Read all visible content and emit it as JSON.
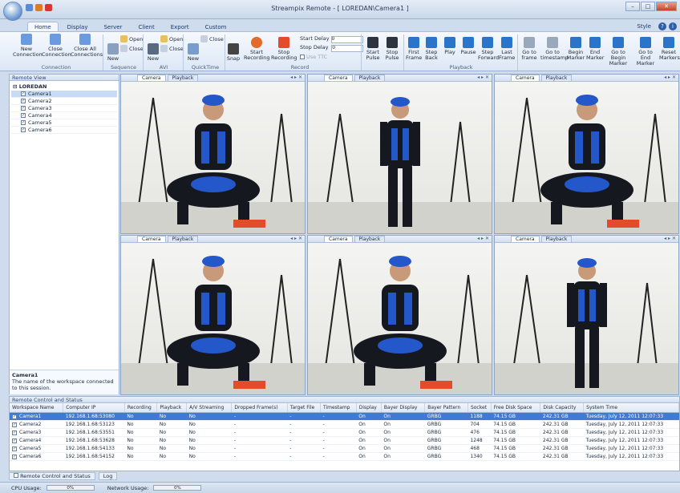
{
  "window": {
    "title": "Streampix Remote - [ LOREDAN\\Camera1 ]",
    "style_label": "Style"
  },
  "ribbon_tabs": [
    "Home",
    "Display",
    "Server",
    "Client",
    "Export",
    "Custom"
  ],
  "ribbon": {
    "new_connection": "New Connection",
    "close_connection": "Close Connection",
    "close_all": "Close All Connections",
    "group_connection": "Connection",
    "seq_new": "New",
    "seq_open": "Open",
    "seq_close": "Close",
    "group_sequence": "Sequence",
    "avi_new": "New",
    "avi_open": "Open",
    "avi_close": "Close",
    "group_avi": "AVI",
    "qt_new": "New",
    "qt_close": "Close",
    "group_qt": "QuickTime",
    "snap": "Snap",
    "start_recording": "Start Recording",
    "stop_recording": "Stop Recording",
    "start_delay_label": "Start Delay",
    "start_delay_value": "0",
    "stop_delay_label": "Stop Delay",
    "stop_delay_value": "0",
    "use_ttc": "Use TTC",
    "group_record": "Record",
    "start_pulse": "Start Pulse",
    "stop_pulse": "Stop Pulse",
    "first_frame": "First Frame",
    "step_back": "Step Back",
    "play": "Play",
    "pause": "Pause",
    "step_forward": "Step Forward",
    "last_frame": "Last Frame",
    "group_playback": "Playback",
    "go_to_frame": "Go to frame",
    "go_to_timestamp": "Go to timestamp",
    "begin_marker": "Begin Marker",
    "end_marker": "End Marker",
    "go_begin_marker": "Go to Begin Marker",
    "go_end_marker": "Go to End Marker",
    "reset_markers": "Reset Markers"
  },
  "remote_view": {
    "title": "Remote View",
    "root": "LOREDAN",
    "cameras": [
      "Camera1",
      "Camera2",
      "Camera3",
      "Camera4",
      "Camera5",
      "Camera6"
    ],
    "selected_name": "Camera1",
    "selected_desc": "The name of the workspace connected to this session."
  },
  "pane_tabs": {
    "camera": "Camera",
    "playback": "Playback"
  },
  "status_panel": {
    "title": "Remote Control and Status",
    "columns": [
      "Workspace Name",
      "Computer IP",
      "Recording",
      "Playback",
      "A/V Streaming",
      "Dropped Frame(s)",
      "Target File",
      "Timestamp",
      "Display",
      "Bayer Display",
      "Bayer Pattern",
      "Socket",
      "Free Disk Space",
      "Disk Capacity",
      "System Time"
    ],
    "rows": [
      [
        "Camera1",
        "192.168.1.68:53080",
        "No",
        "No",
        "No",
        "-",
        "-",
        "-",
        "On",
        "On",
        "GRBG",
        "1188",
        "74.15 GB",
        "242.31 GB",
        "Tuesday, July 12, 2011 12:07:33"
      ],
      [
        "Camera2",
        "192.168.1.68:53123",
        "No",
        "No",
        "No",
        "-",
        "-",
        "-",
        "On",
        "On",
        "GRBG",
        "704",
        "74.15 GB",
        "242.31 GB",
        "Tuesday, July 12, 2011 12:07:33"
      ],
      [
        "Camera3",
        "192.168.1.68:53551",
        "No",
        "No",
        "No",
        "-",
        "-",
        "-",
        "On",
        "On",
        "GRBG",
        "476",
        "74.15 GB",
        "242.31 GB",
        "Tuesday, July 12, 2011 12:07:33"
      ],
      [
        "Camera4",
        "192.168.1.68:53628",
        "No",
        "No",
        "No",
        "-",
        "-",
        "-",
        "On",
        "On",
        "GRBG",
        "1248",
        "74.15 GB",
        "242.31 GB",
        "Tuesday, July 12, 2011 12:07:33"
      ],
      [
        "Camera5",
        "192.168.1.68:54133",
        "No",
        "No",
        "No",
        "-",
        "-",
        "-",
        "On",
        "On",
        "GRBG",
        "468",
        "74.15 GB",
        "242.31 GB",
        "Tuesday, July 12, 2011 12:07:33"
      ],
      [
        "Camera6",
        "192.168.1.68:54152",
        "No",
        "No",
        "No",
        "-",
        "-",
        "-",
        "On",
        "On",
        "GRBG",
        "1340",
        "74.15 GB",
        "242.31 GB",
        "Tuesday, July 12, 2011 12:07:33"
      ]
    ]
  },
  "bottom_tabs": [
    "Remote Control and Status",
    "Log"
  ],
  "statusbar": {
    "cpu_label": "CPU Usage:",
    "cpu_value": "0%",
    "cpu_level": 0,
    "net_label": "Network Usage:",
    "net_value": "0%",
    "net_level": 0
  },
  "colors": {
    "suit": "#16181f",
    "marker_blue": "#2457c9",
    "stop_red": "#e34b2a",
    "ribbon_blue": "#2d5ea8"
  }
}
